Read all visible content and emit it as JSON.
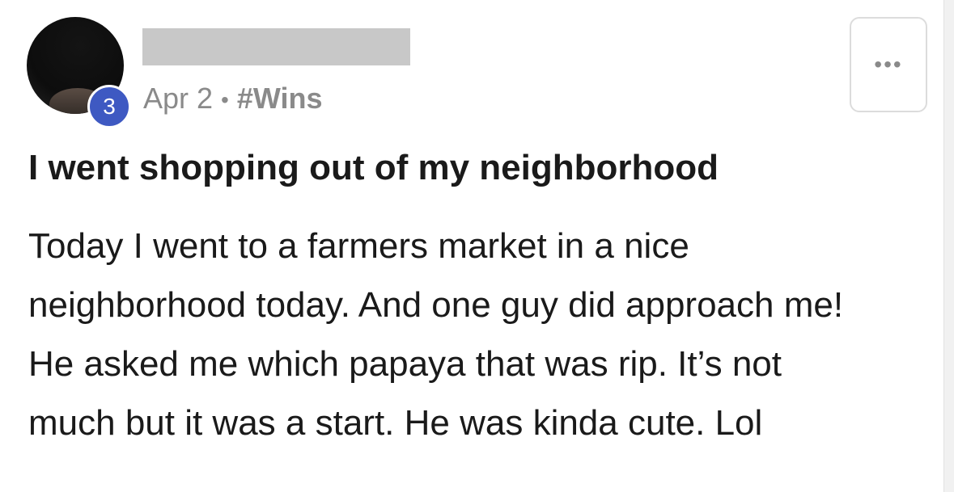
{
  "post": {
    "author": {
      "avatar_alt": "user avatar",
      "level_badge": "3"
    },
    "date": "Apr 2",
    "separator": "•",
    "tag": "#Wins",
    "menu_icon": "more-horizontal-icon",
    "menu_glyph": "•••",
    "title": "I went shopping out of my neighborhood",
    "body_lines": [
      "Today I went to a farmers market in a nice",
      "neighborhood today. And one guy did approach me!",
      "He asked me which papaya that was rip. It’s not",
      "much but it was a start. He was kinda cute. Lol"
    ]
  },
  "colors": {
    "badge": "#3e59c2",
    "meta_text": "#8a8a8a",
    "body_text": "#1a1a1a",
    "redaction": "#c8c8c8"
  }
}
